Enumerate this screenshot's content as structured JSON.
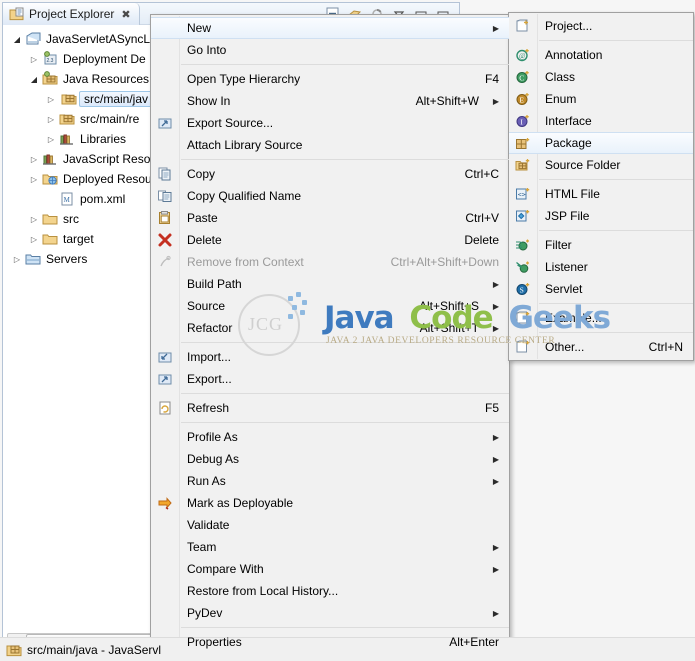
{
  "view": {
    "tab": {
      "label": "Project Explorer",
      "close_glyph": "✖",
      "icon": "project-explorer-icon"
    },
    "toolbar": [
      {
        "name": "collapse-all-icon",
        "glyph": "⊟"
      },
      {
        "name": "link-with-editor-icon",
        "glyph": "⇄"
      },
      {
        "name": "focus-on-active-task-icon",
        "glyph": "◔"
      },
      {
        "name": "view-menu-icon",
        "glyph": "▽"
      },
      {
        "name": "minimize-icon",
        "glyph": "▭"
      },
      {
        "name": "maximize-icon",
        "glyph": "▭"
      }
    ],
    "tree": [
      {
        "label": "JavaServletASyncLi",
        "indent": 1,
        "arrow": "open",
        "icon": "web-project-icon",
        "selected": false
      },
      {
        "label": "Deployment De",
        "indent": 2,
        "arrow": "closed",
        "icon": "deployment-descriptor-icon",
        "selected": false
      },
      {
        "label": "Java Resources",
        "indent": 2,
        "arrow": "open",
        "icon": "java-resources-icon",
        "selected": false
      },
      {
        "label": "src/main/jav",
        "indent": 3,
        "arrow": "closed",
        "icon": "source-folder-icon",
        "selected": true
      },
      {
        "label": "src/main/re",
        "indent": 3,
        "arrow": "closed",
        "icon": "source-folder-icon",
        "selected": false
      },
      {
        "label": "Libraries",
        "indent": 3,
        "arrow": "closed",
        "icon": "libraries-icon",
        "selected": false
      },
      {
        "label": "JavaScript Reso",
        "indent": 2,
        "arrow": "closed",
        "icon": "libraries-icon",
        "selected": false
      },
      {
        "label": "Deployed Resou",
        "indent": 2,
        "arrow": "closed",
        "icon": "deployed-resources-icon",
        "selected": false
      },
      {
        "label": "pom.xml",
        "indent": 3,
        "arrow": "none",
        "icon": "maven-pom-icon",
        "selected": false
      },
      {
        "label": "src",
        "indent": 2,
        "arrow": "closed",
        "icon": "folder-icon",
        "selected": false
      },
      {
        "label": "target",
        "indent": 2,
        "arrow": "closed",
        "icon": "folder-icon",
        "selected": false
      },
      {
        "label": "Servers",
        "indent": 1,
        "arrow": "closed",
        "icon": "servers-folder-icon",
        "selected": false
      }
    ],
    "scrollbar": {
      "left_arrow": "◀",
      "grip": "|||"
    }
  },
  "statusbar": {
    "icon": "source-folder-icon",
    "text": "src/main/java - JavaServl"
  },
  "context_menu": [
    {
      "label": "New",
      "accel": "",
      "arrow": true,
      "icon": "",
      "sep_after": false,
      "highlight": true,
      "disabled": false
    },
    {
      "label": "Go Into",
      "accel": "",
      "arrow": false,
      "icon": "",
      "sep_after": true,
      "highlight": false,
      "disabled": false
    },
    {
      "label": "Open Type Hierarchy",
      "accel": "F4",
      "arrow": false,
      "icon": "",
      "sep_after": false,
      "highlight": false,
      "disabled": false
    },
    {
      "label": "Show In",
      "accel": "Alt+Shift+W",
      "arrow": true,
      "icon": "",
      "sep_after": false,
      "highlight": false,
      "disabled": false
    },
    {
      "label": "Export Source...",
      "accel": "",
      "arrow": false,
      "icon": "export-source-icon",
      "sep_after": false,
      "highlight": false,
      "disabled": false
    },
    {
      "label": "Attach Library Source",
      "accel": "",
      "arrow": false,
      "icon": "",
      "sep_after": true,
      "highlight": false,
      "disabled": false
    },
    {
      "label": "Copy",
      "accel": "Ctrl+C",
      "arrow": false,
      "icon": "copy-icon",
      "sep_after": false,
      "highlight": false,
      "disabled": false
    },
    {
      "label": "Copy Qualified Name",
      "accel": "",
      "arrow": false,
      "icon": "copy-qualified-icon",
      "sep_after": false,
      "highlight": false,
      "disabled": false
    },
    {
      "label": "Paste",
      "accel": "Ctrl+V",
      "arrow": false,
      "icon": "paste-icon",
      "sep_after": false,
      "highlight": false,
      "disabled": false
    },
    {
      "label": "Delete",
      "accel": "Delete",
      "arrow": false,
      "icon": "delete-icon",
      "sep_after": false,
      "highlight": false,
      "disabled": false
    },
    {
      "label": "Remove from Context",
      "accel": "Ctrl+Alt+Shift+Down",
      "arrow": false,
      "icon": "remove-context-icon",
      "sep_after": false,
      "highlight": false,
      "disabled": true
    },
    {
      "label": "Build Path",
      "accel": "",
      "arrow": true,
      "icon": "",
      "sep_after": false,
      "highlight": false,
      "disabled": false
    },
    {
      "label": "Source",
      "accel": "Alt+Shift+S",
      "arrow": true,
      "icon": "",
      "sep_after": false,
      "highlight": false,
      "disabled": false
    },
    {
      "label": "Refactor",
      "accel": "Alt+Shift+T",
      "arrow": true,
      "icon": "",
      "sep_after": true,
      "highlight": false,
      "disabled": false
    },
    {
      "label": "Import...",
      "accel": "",
      "arrow": false,
      "icon": "import-icon",
      "sep_after": false,
      "highlight": false,
      "disabled": false
    },
    {
      "label": "Export...",
      "accel": "",
      "arrow": false,
      "icon": "export-icon",
      "sep_after": true,
      "highlight": false,
      "disabled": false
    },
    {
      "label": "Refresh",
      "accel": "F5",
      "arrow": false,
      "icon": "refresh-icon",
      "sep_after": true,
      "highlight": false,
      "disabled": false
    },
    {
      "label": "Profile As",
      "accel": "",
      "arrow": true,
      "icon": "",
      "sep_after": false,
      "highlight": false,
      "disabled": false
    },
    {
      "label": "Debug As",
      "accel": "",
      "arrow": true,
      "icon": "",
      "sep_after": false,
      "highlight": false,
      "disabled": false
    },
    {
      "label": "Run As",
      "accel": "",
      "arrow": true,
      "icon": "",
      "sep_after": false,
      "highlight": false,
      "disabled": false
    },
    {
      "label": "Mark as Deployable",
      "accel": "",
      "arrow": false,
      "icon": "mark-deployable-icon",
      "sep_after": false,
      "highlight": false,
      "disabled": false
    },
    {
      "label": "Validate",
      "accel": "",
      "arrow": false,
      "icon": "",
      "sep_after": false,
      "highlight": false,
      "disabled": false
    },
    {
      "label": "Team",
      "accel": "",
      "arrow": true,
      "icon": "",
      "sep_after": false,
      "highlight": false,
      "disabled": false
    },
    {
      "label": "Compare With",
      "accel": "",
      "arrow": true,
      "icon": "",
      "sep_after": false,
      "highlight": false,
      "disabled": false
    },
    {
      "label": "Restore from Local History...",
      "accel": "",
      "arrow": false,
      "icon": "",
      "sep_after": false,
      "highlight": false,
      "disabled": false
    },
    {
      "label": "PyDev",
      "accel": "",
      "arrow": true,
      "icon": "",
      "sep_after": true,
      "highlight": false,
      "disabled": false
    },
    {
      "label": "Properties",
      "accel": "Alt+Enter",
      "arrow": false,
      "icon": "",
      "sep_after": false,
      "highlight": false,
      "disabled": false
    }
  ],
  "new_submenu": [
    {
      "label": "Project...",
      "accel": "",
      "icon": "new-project-icon",
      "sep_after": true,
      "highlight": false
    },
    {
      "label": "Annotation",
      "accel": "",
      "icon": "new-annotation-icon",
      "sep_after": false,
      "highlight": false
    },
    {
      "label": "Class",
      "accel": "",
      "icon": "new-class-icon",
      "sep_after": false,
      "highlight": false
    },
    {
      "label": "Enum",
      "accel": "",
      "icon": "new-enum-icon",
      "sep_after": false,
      "highlight": false
    },
    {
      "label": "Interface",
      "accel": "",
      "icon": "new-interface-icon",
      "sep_after": false,
      "highlight": false
    },
    {
      "label": "Package",
      "accel": "",
      "icon": "new-package-icon",
      "sep_after": false,
      "highlight": true
    },
    {
      "label": "Source Folder",
      "accel": "",
      "icon": "new-source-folder-icon",
      "sep_after": true,
      "highlight": false
    },
    {
      "label": "HTML File",
      "accel": "",
      "icon": "new-html-file-icon",
      "sep_after": false,
      "highlight": false
    },
    {
      "label": "JSP File",
      "accel": "",
      "icon": "new-jsp-file-icon",
      "sep_after": true,
      "highlight": false
    },
    {
      "label": "Filter",
      "accel": "",
      "icon": "new-filter-icon",
      "sep_after": false,
      "highlight": false
    },
    {
      "label": "Listener",
      "accel": "",
      "icon": "new-listener-icon",
      "sep_after": false,
      "highlight": false
    },
    {
      "label": "Servlet",
      "accel": "",
      "icon": "new-servlet-icon",
      "sep_after": true,
      "highlight": false
    },
    {
      "label": "Example...",
      "accel": "",
      "icon": "new-example-icon",
      "sep_after": true,
      "highlight": false
    },
    {
      "label": "Other...",
      "accel": "Ctrl+N",
      "icon": "new-other-icon",
      "sep_after": false,
      "highlight": false
    }
  ],
  "watermark": {
    "word1": "Java",
    "word2": "Code",
    "word3": "Geeks",
    "color1": "#3f7bbf",
    "color2": "#8fbf4a",
    "color3": "#7fa9d6",
    "tagline": "JAVA 2 JAVA DEVELOPERS RESOURCE CENTER",
    "monogram": "JCG"
  }
}
